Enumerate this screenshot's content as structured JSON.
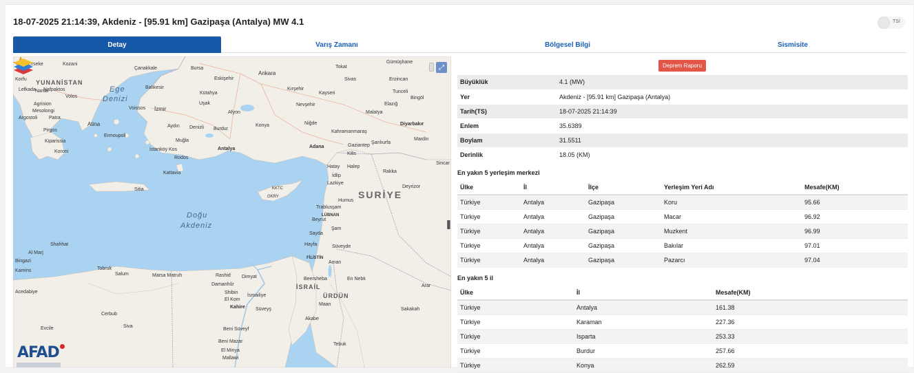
{
  "header": {
    "title": "18-07-2025 21:14:39, Akdeniz - [95.91 km] Gazipaşa (Antalya) MW 4.1",
    "toggle_label": "TSİ"
  },
  "tabs": [
    {
      "label": "Detay",
      "active": true
    },
    {
      "label": "Varış Zamanı",
      "active": false
    },
    {
      "label": "Bölgesel Bilgi",
      "active": false
    },
    {
      "label": "Sismisite",
      "active": false
    }
  ],
  "report_button": "Deprem Raporu",
  "details": [
    {
      "key": "Büyüklük",
      "value": "4.1 (MW)"
    },
    {
      "key": "Yer",
      "value": "Akdeniz - [95.91 km] Gazipaşa (Antalya)"
    },
    {
      "key": "Tarih(TS)",
      "value": "18-07-2025 21:14:39"
    },
    {
      "key": "Enlem",
      "value": "35.6389"
    },
    {
      "key": "Boylam",
      "value": "31.5511"
    },
    {
      "key": "Derinlik",
      "value": "18.05 (KM)"
    }
  ],
  "settlements": {
    "title": "En yakın 5 yerleşim merkezi",
    "headers": [
      "Ülke",
      "İl",
      "İlçe",
      "Yerleşim Yeri Adı",
      "Mesafe(KM)"
    ],
    "rows": [
      [
        "Türkiye",
        "Antalya",
        "Gazipaşa",
        "Koru",
        "95.66"
      ],
      [
        "Türkiye",
        "Antalya",
        "Gazipaşa",
        "Macar",
        "96.92"
      ],
      [
        "Türkiye",
        "Antalya",
        "Gazipaşa",
        "Muzkent",
        "96.99"
      ],
      [
        "Türkiye",
        "Antalya",
        "Gazipaşa",
        "Bakılar",
        "97.01"
      ],
      [
        "Türkiye",
        "Antalya",
        "Gazipaşa",
        "Pazarcı",
        "97.04"
      ]
    ]
  },
  "provinces": {
    "title": "En yakın 5 il",
    "headers": [
      "Ülke",
      "İl",
      "Mesafe(KM)"
    ],
    "rows": [
      [
        "Türkiye",
        "Antalya",
        "161.38"
      ],
      [
        "Türkiye",
        "Karaman",
        "227.36"
      ],
      [
        "Türkiye",
        "Isparta",
        "253.33"
      ],
      [
        "Türkiye",
        "Burdur",
        "257.66"
      ],
      [
        "Türkiye",
        "Konya",
        "262.59"
      ]
    ]
  },
  "map": {
    "logo": "AFAD",
    "labels": {
      "erseke": "Erseke",
      "kozani": "Kozani",
      "canakkale": "Çanakkale",
      "bursa": "Bursa",
      "ankara": "Ankara",
      "tokat": "Tokat",
      "gumushane": "Gümüşhane",
      "yunanistan": "YUNANİSTAN",
      "ege": "Ege",
      "denizi": "Denizi",
      "eskisehir": "Eskişehir",
      "sivas": "Sivas",
      "erzincan": "Erzincan",
      "lefkada": "Lefkada",
      "nafpaktos": "Nafpaktos",
      "balikesir": "Balıkesir",
      "kutahya": "Kütahya",
      "kirsehir": "Kırşehir",
      "kayseri": "Kayseri",
      "tunceli": "Tunceli",
      "korfu": "Korfu",
      "narda": "Narda",
      "volos": "Volos",
      "bingol": "Bingöl",
      "agrinion": "Agrinion",
      "voissos": "Voissos",
      "izmir": "İzmir",
      "usak": "Uşak",
      "nevsehir": "Nevşehir",
      "elazig": "Elazığ",
      "mesolongi": "Mesolongi",
      "afyon": "Afyon",
      "malatya": "Malatya",
      "argostoli": "Argostoli",
      "patra": "Patra",
      "aydin": "Aydın",
      "denizli": "Denizli",
      "burdur": "Burdur",
      "konya": "Konya",
      "nigde": "Niğde",
      "kahramanmaras": "Kahramanmaraş",
      "diyarbakir": "Diyarbakır",
      "pirgos": "Pirgos",
      "atina": "Atina",
      "mugla": "Muğla",
      "adana": "Adana",
      "mardin": "Mardin",
      "kiparissia": "Kiparissia",
      "ermoupoli": "Ermoupoli",
      "antalya": "Antalya",
      "gaziantep": "Gaziantep",
      "sanliurfa": "Şanlıurfa",
      "koroni": "Koroni",
      "istankoy": "İstanköy Kos",
      "rodos": "Rodos",
      "kilis": "Kilis",
      "sincar": "Sincar",
      "kattavia": "Kattavia",
      "hatay": "Hatay",
      "halep": "Halep",
      "rakka": "Rakka",
      "idlip": "İdlip",
      "sitia": "Sitia",
      "lazkiye": "Lazkiye",
      "ktt": "KKTC",
      "deyrizor": "Deyrizor",
      "suriye": "SURİYE",
      "gkry": "GKRY",
      "humus": "Humus",
      "dogu": "Doğu",
      "akdeniz": "Akdeniz",
      "trablusam": "Trablusşam",
      "lubnan": "LÜBNAN",
      "beyrut": "Beyrut",
      "sam": "Şam",
      "sayda": "Sayda",
      "hayfa": "Hayfa",
      "suveyde": "Süveyde",
      "shahhat": "Shahhat",
      "almarj": "Al Marj",
      "filistin": "FİLİSTİN",
      "bingazi": "Bingazi",
      "aman": "Aman",
      "kamins": "Kamins",
      "tobruk": "Tobruk",
      "israil": "İSRAİL",
      "urdun": "ÜRDÜN",
      "salum": "Salum",
      "marsamatruh": "Marsa Matruh",
      "rashid": "Rashid",
      "dimyat": "Dimyat",
      "kahire": "Kahire",
      "acedabiye": "Acedabiye",
      "ismailiye": "İsmailiye",
      "beersheba": "Beersheba",
      "enakib": "En Nebk",
      "arar": "Arar",
      "damanhur": "Damanhûr",
      "shibin": "Shibin",
      "elkom": "El Kom",
      "suveys": "Süveyş",
      "maan": "Maan",
      "sakakah": "Sakakah",
      "akabe": "Akabe",
      "cerbub": "Cerbub",
      "siva": "Siva",
      "evcile": "Evcile",
      "benisuveyf": "Beni Süveyf",
      "tabuk": "Tebuk",
      "benimazar": "Beni Mazar",
      "elminya": "El Minya",
      "mallawi": "Mallawi"
    }
  },
  "colors": {
    "tab_active": "#1559a8",
    "tab_text": "#1a5fb4",
    "report_button": "#e15647",
    "sea": "#aad3f2",
    "land": "#f2efe9",
    "star": "#f5b228"
  }
}
